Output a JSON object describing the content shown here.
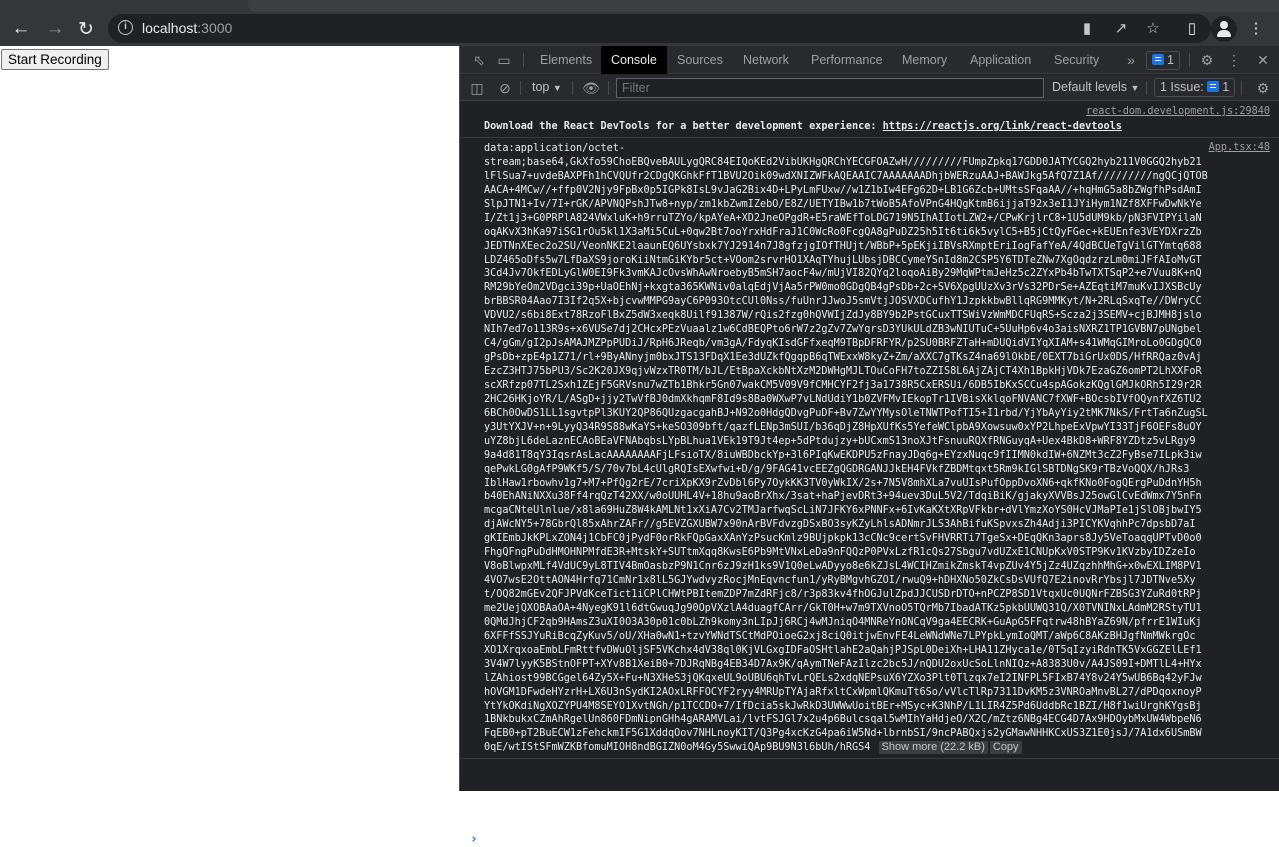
{
  "browser": {
    "url_host": "localhost",
    "url_port": ":3000",
    "icons": {
      "back": "arrow-left-icon",
      "forward": "arrow-right-icon",
      "reload": "reload-icon",
      "site_info": "info-icon",
      "camera": "video-camera-icon",
      "share": "share-icon",
      "bookmark": "star-icon",
      "sidepanel": "side-panel-icon",
      "profile": "profile-icon",
      "menu": "kebab-menu-icon"
    }
  },
  "page": {
    "record_button": "Start Recording"
  },
  "devtools": {
    "tabs": [
      "Elements",
      "Console",
      "Sources",
      "Network",
      "Performance",
      "Memory",
      "Application",
      "Security"
    ],
    "active_tab": "Console",
    "more_tabs": "»",
    "issues_badge_count": "1",
    "context_select": "top",
    "filter_placeholder": "Filter",
    "levels_select": "Default levels",
    "issues_label": "1 Issue:",
    "issues_count": "1",
    "accent": "#1a73e8",
    "logs": [
      {
        "source": "react-dom.development.js:29840",
        "text": "Download the React DevTools for a better development experience: ",
        "link": "https://reactjs.org/link/react-devtools"
      },
      {
        "source": "App.tsx:48",
        "lines": [
          "data:application/octet-",
          "stream;base64,GkXfo59ChoEBQveBAULygQRC84EIQoKEd2VibUKHgQRChYECGFOAZwH/////////FUmpZpkq17GDD0JATYCGQ2hyb211V0GGQ2hyb21",
          "lFlSua7+uvdeBAXPFh1hCVQUfr2CDgQKGhkFfT1BVU2Oik09wdXNIZWFkAQEAAIC7AAAAAAADhjbWERzuAAJ+BAWJkg5AfQ7Z1Af/////////ngQCjQTOB",
          "AACA+4MCw//+ffp0V2Njy9FpBx0p5IGPk8IsL9vJaG2Bix4D+LPyLmFUxw//w1Z1bIw4EFg62D+LB1G6Zcb+UMtsSFqaAA//+hqHmG5a8bZWgfhPsdAmI",
          "SlpJTN1+Iv/7I+rGK/APVNQPshJTw8+nyp/zm1kbZwmIZebO/E8Z/UETYIBw1b7tWoB5AfoVPnG4HQgKtmB6ijjaT92x3eI1JYiHym1NZf8XFFwDwNkYe",
          "I/Zt1j3+G0PRPlA824VWxluK+h9rruTZYo/kpAYeA+XD2JneOPgdR+E5raWEfToLDG719N5IhAIIotLZW2+/CPwKrjlrC8+1U5dUM9kb/pN3FVIPYilaN",
          "oqAKvX3hKa97iSG1rOu5kl1X3aMi5CuL+0qw2Bt7ooYrxHdFraJ1C0WcRo0FcgQA8gPuDZ25h5It6ti6k5vylC5+B5jCtQyFGec+kEUEnfe3VEYDXrzZb",
          "JEDTNnXEec2o2SU/VeonNKE2laaunEQ6UYsbxk7YJ2914n7J8gfzjgIOfTHUjt/WBbP+5pEKjiIBVsRXmptEriIogFafYeA/4QdBCUeTgVilGTYmtq688",
          "LDZ465oDfs5w7LfDaXS9joroKiiNtmGiKYbr5ct+VOom2srvrHO1XAqTYhujLUbsjDBCCymeYSnId8m2CSP5Y6TDTeZNw7XgOqdzrzLm0miJFfAIoMvGT",
          "3Cd4Jv7OkfEDLyGlW0EI9Fk3vmKAJcOvsWhAwNroebyB5mSH7aocF4w/mUjVI82QYq2loqoAiBy29MqWPtmJeHz5c2ZYxPb4bTwTXTSqP2+e7Vuu8K+nQ",
          "RM29bYeOm2VDgci39p+UaOEhNj+kxgta365KWNiv0alqEdjVjAa5rPW0mo0GDgQB4gPsDb+2c+SV6XpgUUzXv3rVs32PDrSe+AZEqtiM7muKvIJXSBcUy",
          "brBBSR04Aao7I3If2q5X+bjcvwMMPG9ayC6P093OtcCUl0Nss/fuUnrJJwoJ5smVtjJOSVXDCufhY1JzpkkbwBllqRG9MMKyt/N+2RLqSxqTe//DWryCC",
          "VDVU2/s6bi8Ext78RzoFlBxZ5dW3xeqk8Uilf91387W/rQis2fzg0hQVWIjZdJy8BY9b2PstGCuxTTSWiVzWmMDCFUqRS+Scza2j3SEMV+cjBJMH8jslo",
          "NIh7ed7o113R9s+x6VUSe7dj2CHcxPEzVuaalz1w6CdBEQPto6rW7z2gZv7ZwYqrsD3YUkULdZB3wNIUTuC+5UuHp6v4o3aisNXRZ1TP1GVBN7pUNgbel",
          "C4/gGm/gI2pJsAMAJMZPpPUDiJ/RpH6JReqb/vm3gA/FdyqKIsdGFfxeqM9TBpDFRFYR/p2SU0BRFZTaH+mDUQidVIYqXIAM+s41WMqGIMroLo0GDgQC0",
          "gPsDb+zpE4p1Z71/rl+9ByANnyjm0bxJTS13FDqX1Ee3dUZkfQgqpB6qTWExxW8kyZ+Zm/aXXC7gTKsZ4na69lOkbE/0EXT7biGrUx0DS/HfRRQaz0vAj",
          "EzcZ3HTJ75bPU3/Sc2K20JX9qjvWzxTR0TM/bJL/EtBpaXckbNtXzM2DWHgMJLTOuCoFH7toZZIS8L6AjZAjCT4Xh1BpkHjVDk7EzaGZ6omPT2LhXXFoR",
          "scXRfzp07TL2Sxh1ZEjF5GRVsnu7wZTb1Bhkr5Gn07wakCM5V09V9fCMHCYF2fj3a1738R5CxERSUi/6DB5IbKxSCCu4spAGokzKQglGMJkORh5I29r2R",
          "2HC26HKjoYR/L/ASgD+jjy2TwVfBJ0dmXkhqmF8Id9s8Ba0WXwP7vLNdUdiY1b0ZVFMvIEkopTr1IVBisXklqoFNVANC7fXWF+BOcsbIVfOQynfXZ6TU2",
          "6BCh0OwDS1LL1sgvtpPl3KUY2QP86QUzgacgahBJ+N92o0HdgQDvgPuDF+Bv7ZwYYMysOleTNWTPofTI5+I1rbd/YjYbAyYiy2tMK7NkS/FrtTa6nZugSL",
          "y3UtYXJV+n+9LyyQ34R9S88wKaYS+keSO309bft/qazfLENp3mSUI/b36qDjZ8HpXUfKs5YefeWClpbA9Xowsuw0xYP2LhpeExVpwYI33TjF6OEFs8uOY",
          "uYZ8bjL6deLaznECAoBEaVFNAbqbsLYpBLhua1VEk19T9Jt4ep+5dPtdujzy+bUCxmS13noXJtFsnuuRQXfRNGuyqA+Uex4BkD8+WRF8YZDtz5vLRgy9",
          "9a4d81T8qY3IqsrAsLacAAAAAAAAFjLFsioTX/8iuWBDbckYp+3l6PIqKwEKDPU5zFnayJDq6g+EYzxNuqc9fIIMN0kdIW+6NZMt3cZ2FyBse7ILpk3iw",
          "qePwkLG0gAfP9WKf5/S/70v7bL4cUlgRQIsEXwfwi+D/g/9FAG41vcEEZgQGDRGANJJkEH4FVkfZBDMtqxt5Rm9kIGlSBTDNgSK9rTBzVoQQX/hJRs3",
          "IblHaw1rbowhv1g7+M7+PfQg2rE/7criXpKX9rZvDbl6Py7OykKK3TV0yWkIX/2s+7N5V8mhXLa7vuUIsPufOppDvoXN6+qkfKNo0FogQErgPuDdnYH5h",
          "b40EhANiNXXu38Ff4rqQzT42XX/w0oUUHL4V+18hu9aoBrXhx/3sat+haPjevDRt3+94uev3DuL5V2/TdqiBiK/gjakyXVVBsJ25owGlCvEdWmx7Y5nFn",
          "mcgaCNteUlnlue/x8la69HuZ8W4kAMLNt1xXiA7Cv2TMJarfwqScLiN7JFKY6xPNNFx+6IvKaKXtXRpVFkbr+dVlYmzXoYS0HcVJMaPIe1jSlOBjbwIY5",
          "djAWcNY5+78GbrQl85xAhrZAFr//g5EVZGXUBW7x90nArBVFdvzgDSxBO3syKZyLhlsADNmrJLS3AhBifuKSpvxsZh4Adji3PICYKVqhhPc7dpsbD7aI",
          "gKIEmbJkKPLxZON4j1CbFC0jPydF0orRkFQpGaxXAnYzPsucKmlz9BUjpkpk13cCNc9certSvFHVRRTi7TgeSx+DEqQKn3aprs8Jy5VeToaqqUPTvD0o0",
          "FhgQFngPuDdHMOHNPMfdE3R+MtskY+SUTtmXqq8KwsE6Pb9MtVNxLeDa9nFQQzP0PVxLzfR1cQs27Sbgu7vdUZxE1CNUpKxV0STP9Kv1KVzbyIDZzeIo",
          "V8oBlwpxMLf4VdUC9yL8TIV4BmOasbzP9N1Cnr6zJ9zH1ks9V1Q0eLwADyyo8e6kZJsL4WCIHZmikZmskT4vpZUv4Y5jZz4UZqzhhMhG+x0wEXLIM8PV1",
          "4VO7wsE2OttAON4Hrfq71CmNr1x8lL5GJYwdvyzRocjMnEqvncfun1/yRyBMgvhGZOI/rwuQ9+hDHXNo50ZkCsDsVUfQ7E2inovRrYbsjl7JDTNve5Xy",
          "t/OQ82mGEv2QFJPVdKceTict1iCPlCHWtPBItemZDP7mZdRFjc8/r3p83kv4fhOGJulZpdJJCUSDrDTO+nPCZP8SD1VtqxUc0UQNrFZBSG3YZuRd0tRPj",
          "me2UejQXOBAaOA+4NyegK91l6dtGwuqJg90OpVXzlA4duagfCArr/GkT0H+w7m9TXVnoO5TQrMb7IbadATKz5pkbUUWQ31Q/X0TVNINxLAdmM2RStyTU1",
          "0QMdJhjCF2qb9HAmsZ3uXI0O3A30p01c0bLZh9komy3nLIpJj6RCj4wMJniqO4MNReYnONCqV9ga4EECRK+GuApG5FFqtrw48hBYaZ69N/pfrrE1WIuKj",
          "6XFFfSSJYuRiBcqZyKuv5/oU/XHa0wN1+tzvYWNdTSCtMdPOioeG2xj8ciQ0itjwEnvFE4LeWNdWNe7LPYpkLymIoQMT/aWp6C8AKzBHJgfNmMWkrgOc",
          "XO1XrqxoaEmbLFmRttfvDWuOljSF5VKchx4dV38ql0KjVLGxgIDFaOSHtlahE2aQahjPJSpL0DeiXh+LHA11ZHyca1e/0T5qIzyiRdnTK5VxGGZElLEf1",
          "3V4W7lyyK5BStnOFPT+XYv8B1XeiB0+7DJRqNBg4EB34D7Ax9K/qAymTNeFAzIlzc2bc5J/nQDU2oxUcSoLlnNIQz+A8383U0v/A4JS09I+DMTlL4+HYx",
          "lZAhiost99BCGgel64Zy5X+Fu+N3XHeS3jQKqxeUL9oUBU6qhTvLrQELs2xdqNEPsuX6YZXo3Plt0Tlzqx7eI2INFPL5FIxB74Y8v24Y5wUB6Bq42yFJw",
          "hOVGM1DFwdeHYzrH+LX6U3nSydKI2AOxLRFFOCYF2ryy4MRUpTYAjaRfxltCxWpmlQKmuTt6So/vVlcTlRp7311DvKM5z3VNROaMnvBL27/dPDqoxnoyP",
          "YtYkOKdiNgXOZYPU4M8SEYO1XvtNGh/p1TCCDO+7/IfDcia5skJwRkD3UWWwUoitBEr+MSyc+K3NhP/L1LIR4Z5Pd6UddbRc1BZI/H8f1wiUrghKYgsBj",
          "1BNkbukxCZmAhRgelUn860FDmNipnGHh4gARAMVLai/lvtFSJGl7x2u4p6Bulcsqal5wMIhYaHdjeO/X2C/mZtz6NBg4ECG4D7Ax9HDOybMxUW4WbpeN6",
          "FqEB0+pT2BuECW1zFehckmIF5G1XddqOov7NHLnoyKIT/Q3Pg4xcKzG4pa6iW5Nd+lbrnbSI/9ncPABQxjs2yGMawNHHKCxUS3Z1E0jsJ/7A1dx6USmBW",
          "0qE/wtIStSFmWZKBfomuMIOH8ndBGIZN0oM4Gy5SwwiQAp9BU9N3l6bUh/hRGS4"
        ],
        "show_more": "Show more (22.2 kB)",
        "copy": "Copy"
      }
    ],
    "prompt": "›"
  }
}
